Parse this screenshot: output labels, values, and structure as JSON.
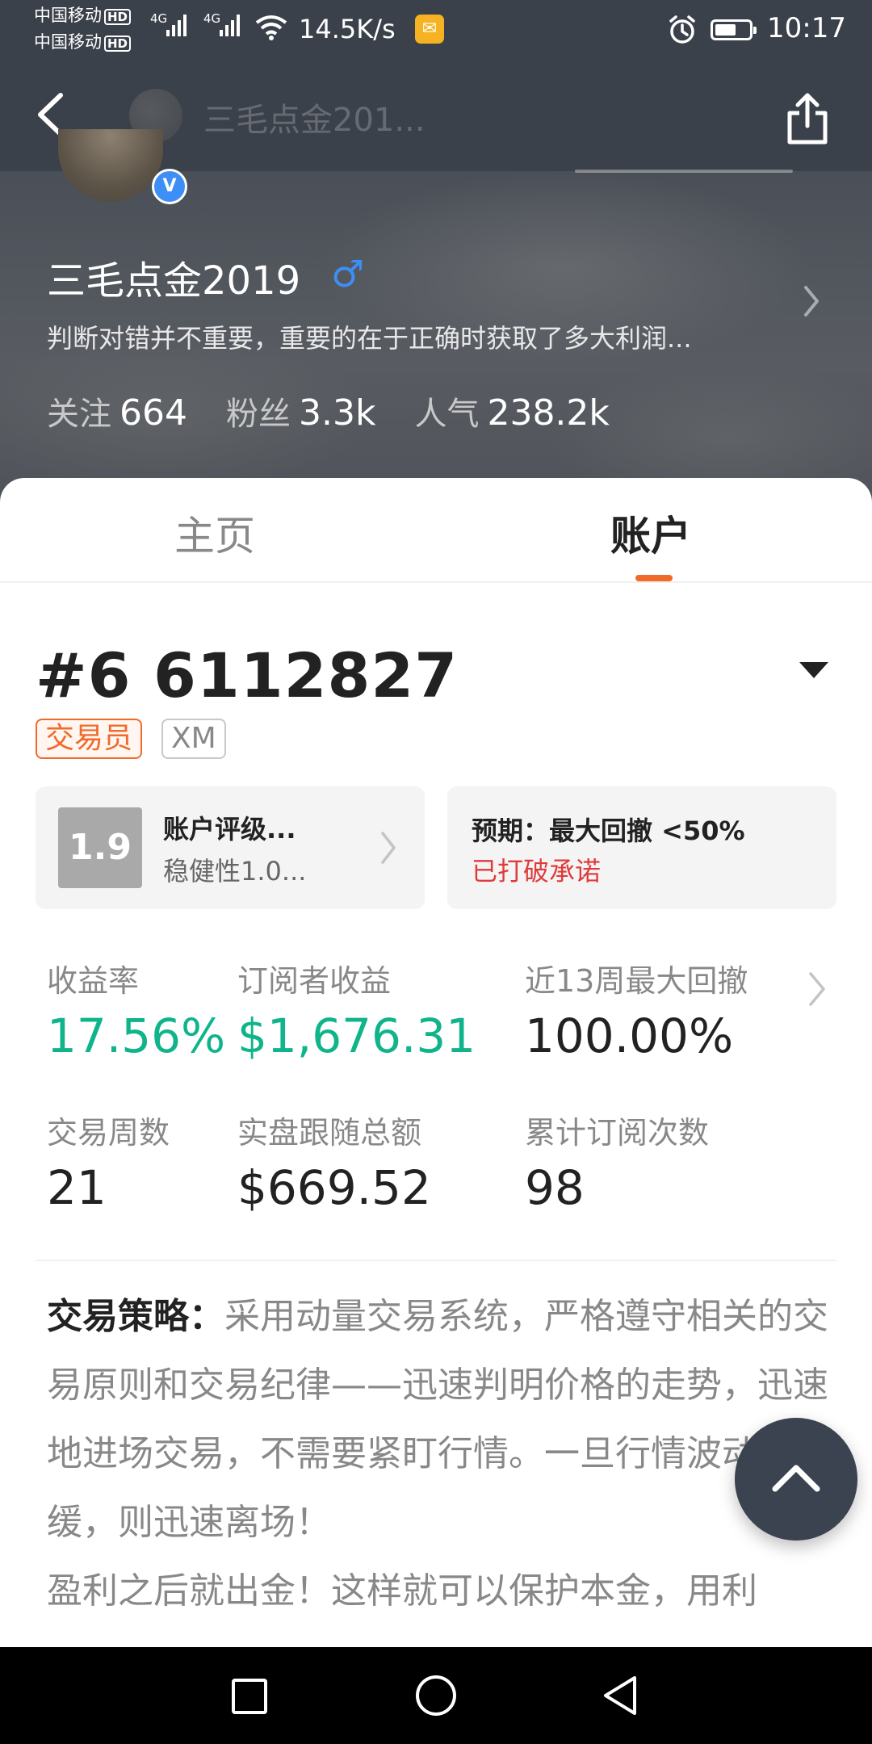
{
  "status_bar": {
    "carrier1": "中国移动",
    "carrier2": "中国移动",
    "hd": "HD",
    "network": "4G",
    "speed": "14.5K/s",
    "time": "10:17",
    "battery_level": 0.55
  },
  "nav": {
    "title": "三毛点金201..."
  },
  "profile": {
    "name": "三毛点金2019",
    "gender_symbol": "♂",
    "verified_mark": "V",
    "bio": "判断对错并不重要，重要的在于正确时获取了多大利润...",
    "stats": [
      {
        "label": "关注",
        "value": "664"
      },
      {
        "label": "粉丝",
        "value": "3.3k"
      },
      {
        "label": "人气",
        "value": "238.2k"
      }
    ]
  },
  "tabs": [
    {
      "label": "主页",
      "active": false
    },
    {
      "label": "账户",
      "active": true
    }
  ],
  "account": {
    "number": "#6 6112827",
    "tags": [
      "交易员",
      "XM"
    ],
    "rating": {
      "score": "1.9",
      "title": "账户评级...",
      "subtitle": "稳健性1.0..."
    },
    "expectation": {
      "title": "预期：最大回撤 <50%",
      "status": "已打破承诺"
    }
  },
  "metrics": [
    {
      "label": "收益率",
      "value": "17.56%",
      "highlight": true
    },
    {
      "label": "订阅者收益",
      "value": "$1,676.31",
      "highlight": true
    },
    {
      "label": "近13周最大回撤",
      "value": "100.00%",
      "highlight": false
    },
    {
      "label": "交易周数",
      "value": "21",
      "highlight": false
    },
    {
      "label": "实盘跟随总额",
      "value": "$669.52",
      "highlight": false
    },
    {
      "label": "累计订阅次数",
      "value": "98",
      "highlight": false
    }
  ],
  "strategy": {
    "heading": "交易策略：",
    "text": "采用动量交易系统，严格遵守相关的交易原则和交易纪律——迅速判明价格的走势，迅速地进场交易，不需要紧盯行情。一旦行情波动趋缓，则迅速离场！",
    "text2": "盈利之后就出金！这样就可以保护本金，用利"
  },
  "colors": {
    "accent": "#f06a2a",
    "positive": "#10b48a",
    "warning": "#e13a3a",
    "header_bg": "#3b414a",
    "verified": "#3d8ef5"
  }
}
